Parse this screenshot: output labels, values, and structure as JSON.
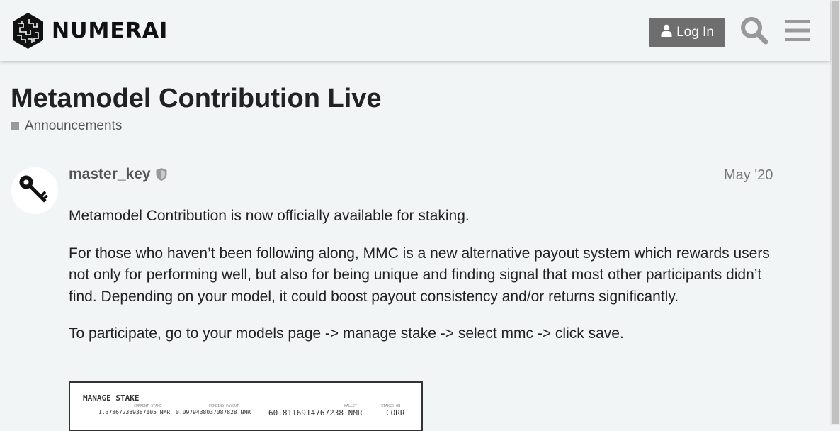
{
  "header": {
    "brand": "NUMERAI",
    "login_label": "Log In",
    "icons": [
      "user-icon",
      "search-icon",
      "hamburger-menu-icon"
    ]
  },
  "topic": {
    "title": "Metamodel Contribution Live",
    "category": "Announcements"
  },
  "post": {
    "username": "master_key",
    "date": "May '20",
    "paragraphs": [
      "Metamodel Contribution is now officially available for staking.",
      "For those who haven’t been following along, MMC is a new alternative payout system which rewards users not only for performing well, but also for being unique and finding signal that most other participants didn’t find. Depending on your model, it could boost payout consistency and/or returns significantly.",
      "To participate, go to your models page -> manage stake -> select mmc -> click save."
    ],
    "image": {
      "heading": "MANAGE STAKE",
      "current_stake_label": "CURRENT STAKE",
      "current_stake_value": "1.378672389387105 NMR",
      "pending_payout_label": "PENDING PAYOUT",
      "pending_payout_value": "0.0979438037087828 NMR",
      "wallet_label": "WALLET",
      "wallet_value": "60.8116914767238 NMR",
      "staked_on_label": "STAKED ON",
      "staked_on_value": "CORR"
    }
  }
}
